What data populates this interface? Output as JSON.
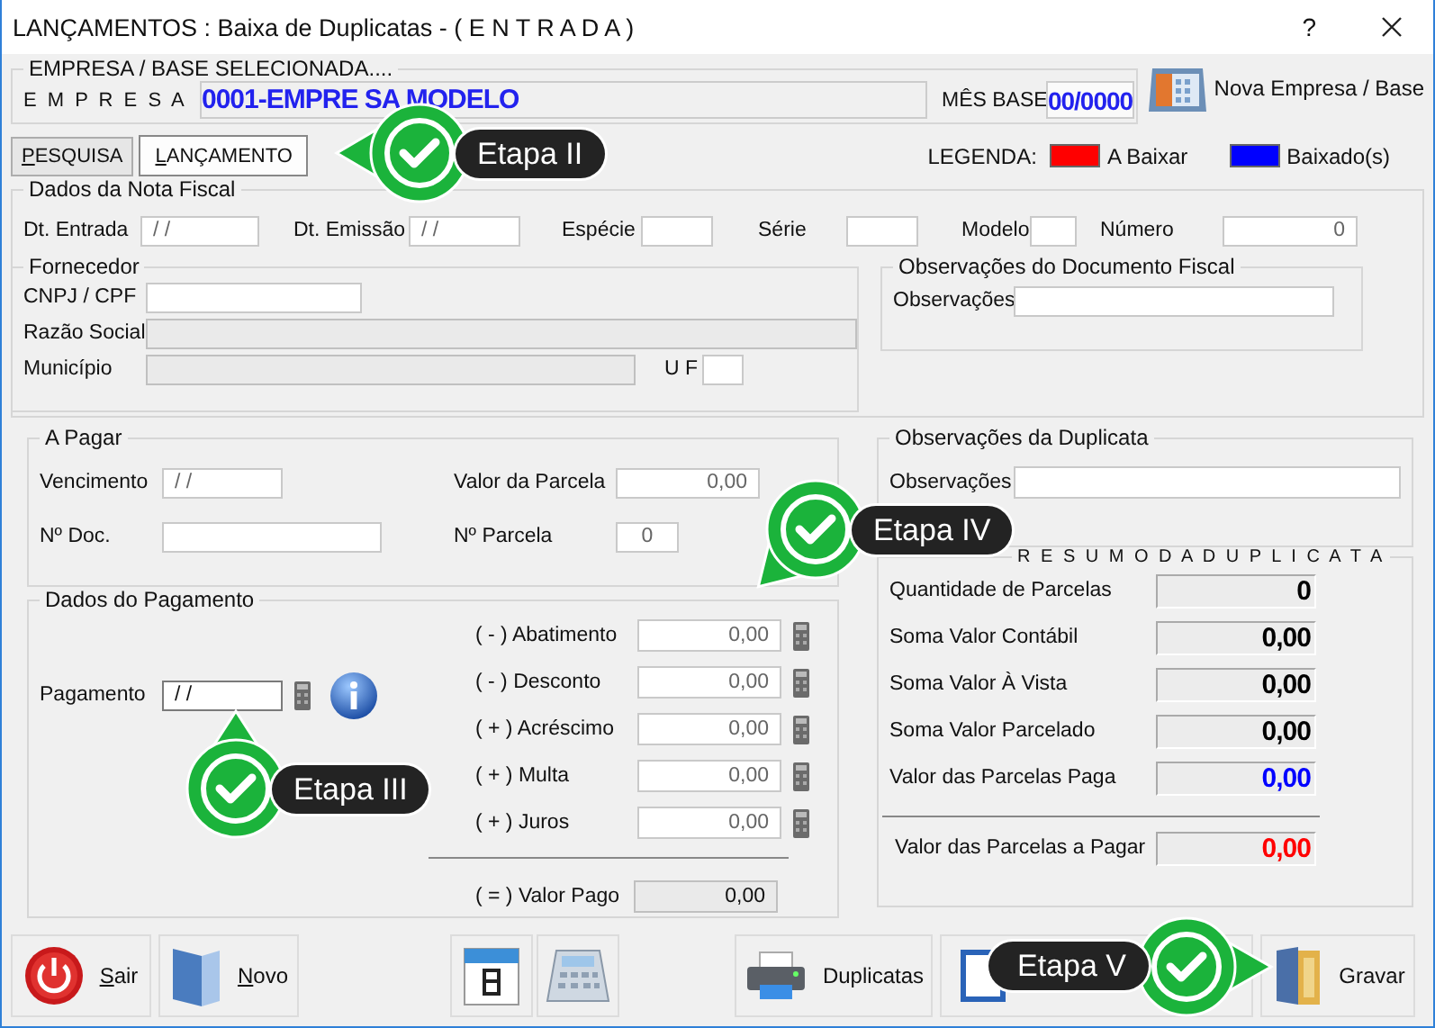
{
  "window": {
    "title": "LANÇAMENTOS : Baixa de Duplicatas - ( E N T R A D A )",
    "help": "?"
  },
  "empresa": {
    "group_title": "EMPRESA  /  BASE  SELECIONADA....",
    "label": "E M P R E S A",
    "value": "0001-EMPRE SA MODELO",
    "mes_base_label": "MÊS BASE",
    "mes_base": "00/0000"
  },
  "nova_empresa_button": "Nova Empresa / Base",
  "tabs": [
    {
      "label": "PESQUISA",
      "selected": false,
      "mnemonic": true
    },
    {
      "label": "LANÇAMENTO",
      "selected": true,
      "mnemonic": true
    }
  ],
  "legend": {
    "label": "LEGENDA:",
    "items": [
      {
        "label": "A Baixar",
        "color": "#ff0000"
      },
      {
        "label": "Baixado(s)",
        "color": "#0000ff"
      }
    ]
  },
  "nota_fiscal": {
    "title": "Dados  da  Nota  Fiscal",
    "fields": [
      {
        "label": "Dt. Entrada",
        "value": "/ /"
      },
      {
        "label": "Dt. Emissão",
        "value": "/ /"
      },
      {
        "label": "Espécie"
      },
      {
        "label": "Série"
      },
      {
        "label": "Modelo"
      },
      {
        "label": "Número",
        "value": "0"
      }
    ]
  },
  "fornecedor": {
    "title": "Fornecedor",
    "cnpj": {
      "label": "CNPJ / CPF",
      "disabled": false
    },
    "razao_social": {
      "label": "Razão Social",
      "disabled": true
    },
    "municipio": {
      "label": "Município",
      "disabled": true
    },
    "uf": {
      "label": "U F",
      "disabled": false
    }
  },
  "obs_documento": {
    "title": "Observações do Documento Fiscal",
    "label": "Observações"
  },
  "a_pagar": {
    "title": "A Pagar",
    "vencimento": {
      "label": "Vencimento",
      "value": "/ /"
    },
    "documento": {
      "label": "Nº  Doc."
    },
    "valor_parcela": {
      "label": "Valor da Parcela",
      "value": "0,00"
    },
    "numero_parcela": {
      "label": "Nº Parcela",
      "value": "0"
    }
  },
  "pagamento": {
    "title": "Dados do  Pagamento",
    "data": {
      "label": "Pagamento",
      "value": "/ /"
    },
    "adjustments": [
      {
        "label": "( - ) Abatimento",
        "value": "0,00"
      },
      {
        "label": "( - ) Desconto",
        "value": "0,00"
      },
      {
        "label": "( + ) Acréscimo",
        "value": "0,00"
      },
      {
        "label": "( + ) Multa",
        "value": "0,00"
      },
      {
        "label": "( + ) Juros",
        "value": "0,00"
      }
    ],
    "total": {
      "label": "( = ) Valor Pago",
      "value": "0,00"
    }
  },
  "obs_duplicata": {
    "title": "Observações da Duplicata",
    "label": "Observações"
  },
  "resumo": {
    "title": "R E S U M O   D A   D U P L I C A T A",
    "rows": [
      {
        "label": "Quantidade de Parcelas",
        "value": "0",
        "color": "#000000",
        "kind": "line"
      },
      {
        "label": "Soma Valor Contábil",
        "value": "0,00",
        "color": "#000000",
        "kind": "line"
      },
      {
        "label": "Soma Valor À Vista",
        "value": "0,00",
        "color": "#000000",
        "kind": "line"
      },
      {
        "label": "Soma Valor Parcelado",
        "value": "0,00",
        "color": "#000000",
        "kind": "line"
      },
      {
        "label": "Valor das Parcelas Paga",
        "value": "0,00",
        "color": "#0000ff",
        "kind": "line"
      },
      {
        "label": "Valor das Parcelas a Pagar",
        "value": "0,00",
        "color": "#ff0000",
        "kind": "total"
      }
    ]
  },
  "toolbar": [
    {
      "kind": "exit",
      "label": "Sair",
      "mnemonic": true
    },
    {
      "kind": "new",
      "label": "Novo",
      "mnemonic": true
    },
    {
      "kind": "calendar"
    },
    {
      "kind": "calculator"
    },
    {
      "kind": "print",
      "label": "Duplicatas",
      "mnemonic": false
    },
    {
      "kind": "batch"
    },
    {
      "kind": "save",
      "label": "Gravar",
      "mnemonic": false
    }
  ],
  "callouts": [
    {
      "label": "Etapa II"
    },
    {
      "label": "Etapa III"
    },
    {
      "label": "Etapa IV"
    },
    {
      "label": "Etapa V"
    }
  ]
}
